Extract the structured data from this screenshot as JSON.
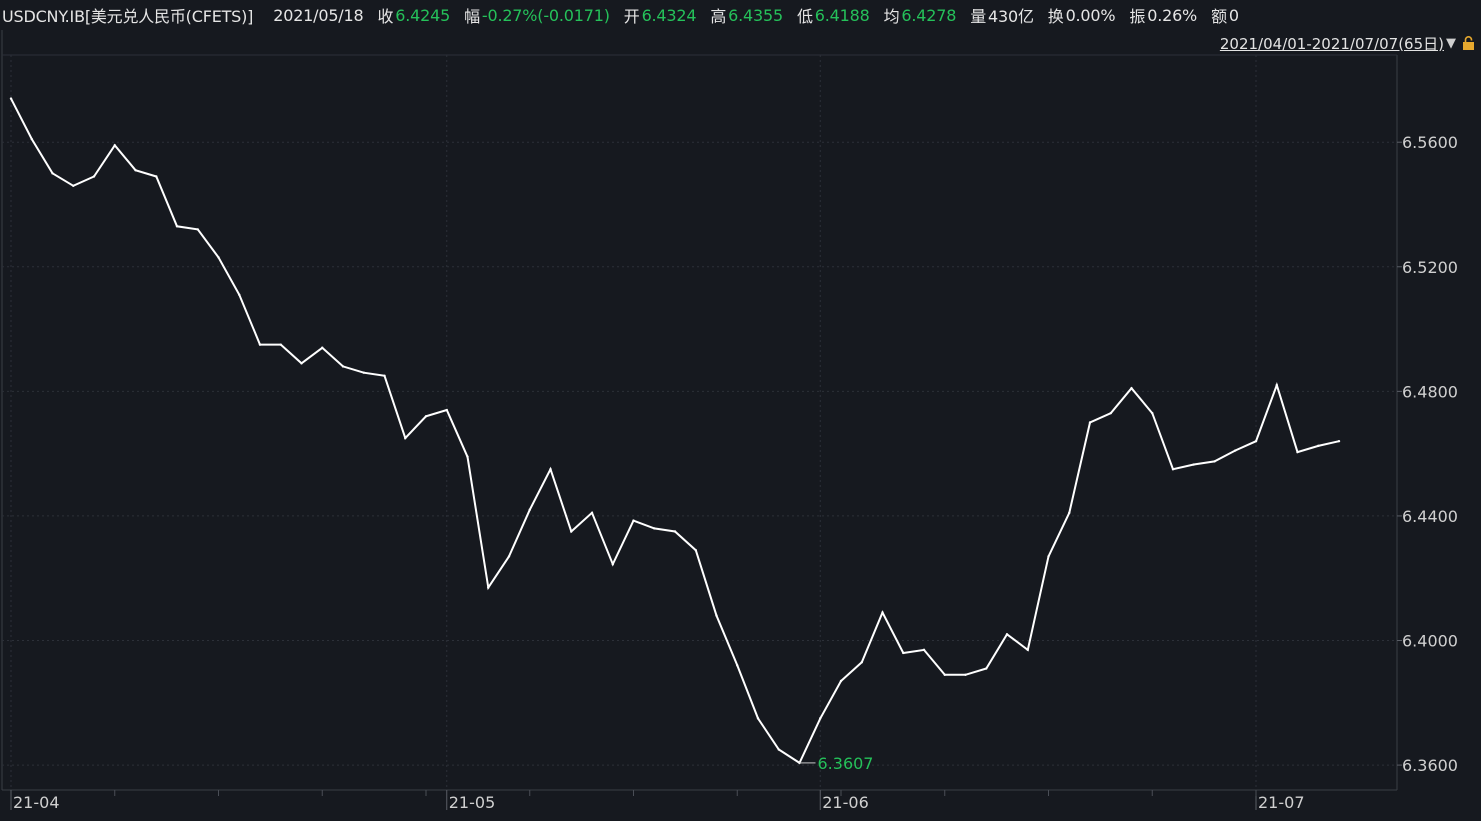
{
  "header": {
    "symbol": "USDCNY.IB[美元兑人民币(CFETS)]",
    "date": "2021/05/18",
    "close_label": "收",
    "close": "6.4245",
    "change_label": "幅",
    "change": "-0.27%(-0.0171)",
    "open_label": "开",
    "open": "6.4324",
    "high_label": "高",
    "high": "6.4355",
    "low_label": "低",
    "low": "6.4188",
    "avg_label": "均",
    "avg": "6.4278",
    "volume_label": "量",
    "volume": "430亿",
    "turnover_label": "换",
    "turnover": "0.00%",
    "amplitude_label": "振",
    "amplitude": "0.26%",
    "amount_label": "额",
    "amount": "0"
  },
  "range": {
    "text": "2021/04/01-2021/07/07(65日)",
    "dropdown_icon": "triangle-down-icon",
    "lock_icon": "lock-icon"
  },
  "colors": {
    "background": "#16191f",
    "line": "#ffffff",
    "grid": "#2c3038",
    "up_down_green": "#25c15a",
    "axis_text": "#d0d0d0"
  },
  "chart_data": {
    "type": "line",
    "x": [
      "2021-04-01",
      "2021-04-02",
      "2021-04-06",
      "2021-04-07",
      "2021-04-08",
      "2021-04-09",
      "2021-04-12",
      "2021-04-13",
      "2021-04-14",
      "2021-04-15",
      "2021-04-16",
      "2021-04-19",
      "2021-04-20",
      "2021-04-21",
      "2021-04-22",
      "2021-04-23",
      "2021-04-26",
      "2021-04-27",
      "2021-04-28",
      "2021-04-29",
      "2021-04-30",
      "2021-05-06",
      "2021-05-07",
      "2021-05-10",
      "2021-05-11",
      "2021-05-12",
      "2021-05-13",
      "2021-05-14",
      "2021-05-17",
      "2021-05-18",
      "2021-05-19",
      "2021-05-20",
      "2021-05-21",
      "2021-05-24",
      "2021-05-25",
      "2021-05-26",
      "2021-05-27",
      "2021-05-28",
      "2021-05-31",
      "2021-06-01",
      "2021-06-02",
      "2021-06-03",
      "2021-06-04",
      "2021-06-07",
      "2021-06-08",
      "2021-06-09",
      "2021-06-10",
      "2021-06-11",
      "2021-06-15",
      "2021-06-16",
      "2021-06-17",
      "2021-06-18",
      "2021-06-21",
      "2021-06-22",
      "2021-06-23",
      "2021-06-24",
      "2021-06-25",
      "2021-06-28",
      "2021-06-29",
      "2021-06-30",
      "2021-07-01",
      "2021-07-02",
      "2021-07-05",
      "2021-07-06",
      "2021-07-07"
    ],
    "values": [
      6.574,
      6.561,
      6.55,
      6.546,
      6.549,
      6.559,
      6.551,
      6.549,
      6.533,
      6.532,
      6.523,
      6.511,
      6.495,
      6.495,
      6.489,
      6.494,
      6.488,
      6.486,
      6.485,
      6.465,
      6.472,
      6.474,
      6.459,
      6.417,
      6.427,
      6.442,
      6.455,
      6.435,
      6.441,
      6.4245,
      6.4385,
      6.436,
      6.435,
      6.429,
      6.408,
      6.392,
      6.375,
      6.365,
      6.3607,
      6.375,
      6.387,
      6.393,
      6.409,
      6.396,
      6.397,
      6.389,
      6.389,
      6.391,
      6.402,
      6.397,
      6.427,
      6.441,
      6.47,
      6.473,
      6.481,
      6.473,
      6.455,
      6.4565,
      6.4575,
      6.461,
      6.464,
      6.482,
      6.4605,
      6.4625,
      6.464
    ],
    "ylim": [
      6.352,
      6.588
    ],
    "yticks": [
      "6.5600",
      "6.5200",
      "6.4800",
      "6.4400",
      "6.4000",
      "6.3600"
    ],
    "ytick_values": [
      6.56,
      6.52,
      6.48,
      6.44,
      6.4,
      6.36
    ],
    "xtick_labels": [
      "21-04",
      "21-05",
      "21-06",
      "21-07"
    ],
    "xtick_dates": [
      "2021-04-01",
      "2021-05-06",
      "2021-06-01",
      "2021-07-01"
    ],
    "annotation": {
      "text": "6.3607",
      "date": "2021-05-31",
      "value": 6.3607
    },
    "grid": true
  }
}
